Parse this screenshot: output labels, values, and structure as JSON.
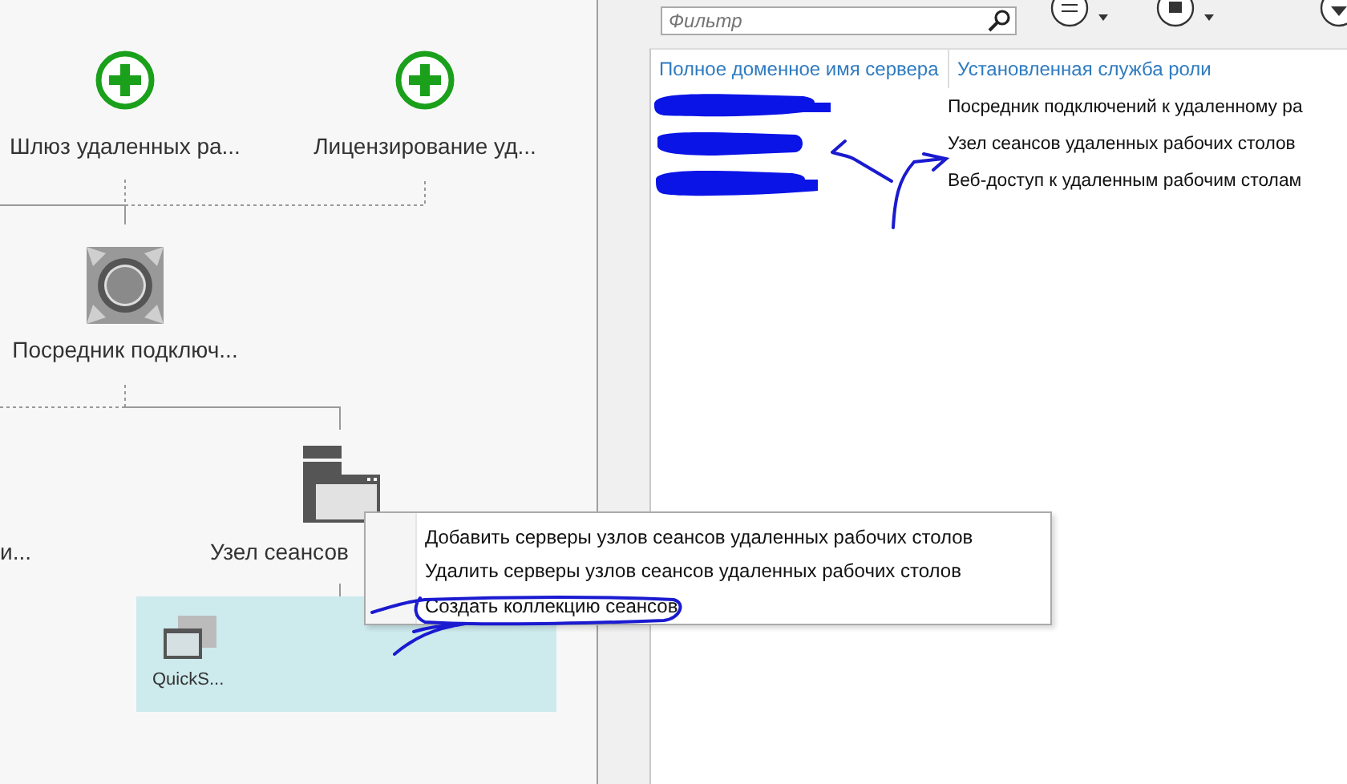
{
  "diagram": {
    "nodes": [
      {
        "kind": "add",
        "label": "Шлюз удаленных ра..."
      },
      {
        "kind": "add",
        "label": "Лицензирование уд..."
      },
      {
        "kind": "broker",
        "label": "Посредник подключ..."
      },
      {
        "kind": "none",
        "label": "и..."
      },
      {
        "kind": "host",
        "label": "Узел сеансов"
      }
    ],
    "collections": [
      {
        "label": "QuickS...",
        "selected": true
      }
    ]
  },
  "context_menu": {
    "items": [
      "Добавить серверы узлов сеансов удаленных рабочих столов",
      "Удалить серверы узлов сеансов удаленных рабочих столов",
      "Создать коллекцию сеансов"
    ]
  },
  "filter": {
    "placeholder": "Фильтр"
  },
  "servers_table": {
    "columns": [
      "Полное доменное имя сервера",
      "Установленная служба роли"
    ],
    "rows": [
      {
        "role": "Посредник подключений к удаленному ра"
      },
      {
        "role": "Узел сеансов удаленных рабочих столов"
      },
      {
        "role": "Веб-доступ к удаленным рабочим столам"
      }
    ]
  }
}
